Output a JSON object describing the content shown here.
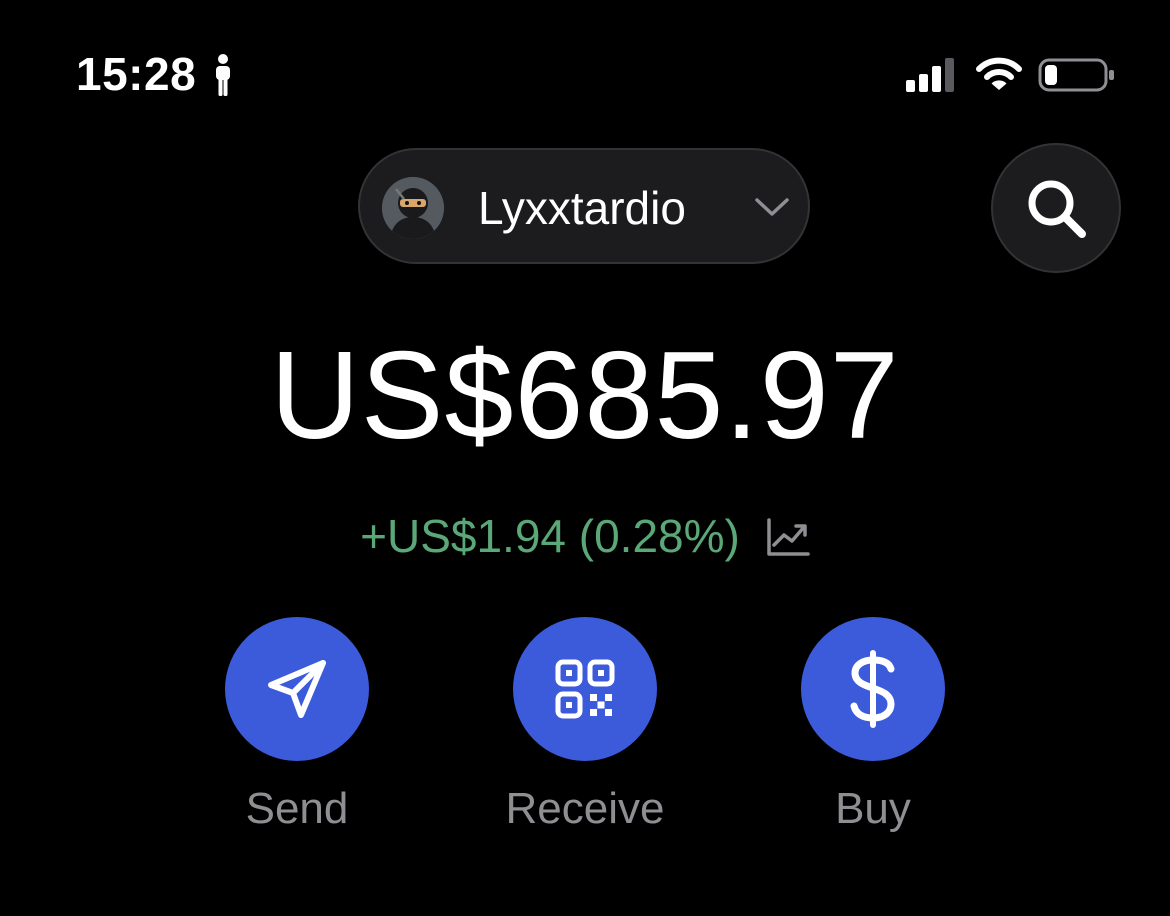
{
  "status_bar": {
    "time": "15:28",
    "icons": [
      "walk-icon",
      "signal-icon",
      "wifi-icon",
      "battery-icon"
    ]
  },
  "header": {
    "account_name": "Lyxxtardio",
    "avatar_icon": "ninja-avatar",
    "dropdown_icon": "chevron-down-icon",
    "search_icon": "search-icon"
  },
  "wallet": {
    "balance": "US$685.97",
    "change": "+US$1.94 (0.28%)",
    "change_icon": "chart-trend-icon"
  },
  "actions": [
    {
      "label": "Send",
      "icon": "send-icon"
    },
    {
      "label": "Receive",
      "icon": "qr-code-icon"
    },
    {
      "label": "Buy",
      "icon": "dollar-icon"
    }
  ],
  "colors": {
    "background": "#000000",
    "accent": "#3b5bdb",
    "positive": "#5aa777",
    "label_gray": "#8e8e93",
    "pill_bg": "#1c1c1e"
  }
}
